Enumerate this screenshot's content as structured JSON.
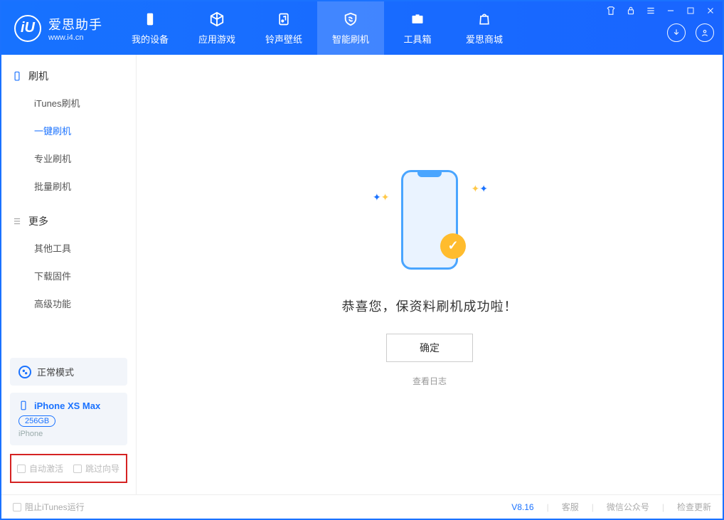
{
  "logo": {
    "title": "爱思助手",
    "subtitle": "www.i4.cn"
  },
  "tabs": [
    {
      "label": "我的设备"
    },
    {
      "label": "应用游戏"
    },
    {
      "label": "铃声壁纸"
    },
    {
      "label": "智能刷机"
    },
    {
      "label": "工具箱"
    },
    {
      "label": "爱思商城"
    }
  ],
  "sidebar": {
    "group1": {
      "head": "刷机",
      "items": [
        "iTunes刷机",
        "一键刷机",
        "专业刷机",
        "批量刷机"
      ]
    },
    "group2": {
      "head": "更多",
      "items": [
        "其他工具",
        "下载固件",
        "高级功能"
      ]
    },
    "mode": "正常模式",
    "device": {
      "name": "iPhone XS Max",
      "capacity": "256GB",
      "type": "iPhone"
    },
    "opt1": "自动激活",
    "opt2": "跳过向导"
  },
  "main": {
    "message": "恭喜您，保资料刷机成功啦！",
    "ok": "确定",
    "log": "查看日志"
  },
  "footer": {
    "left": "阻止iTunes运行",
    "version": "V8.16",
    "links": [
      "客服",
      "微信公众号",
      "检查更新"
    ]
  }
}
